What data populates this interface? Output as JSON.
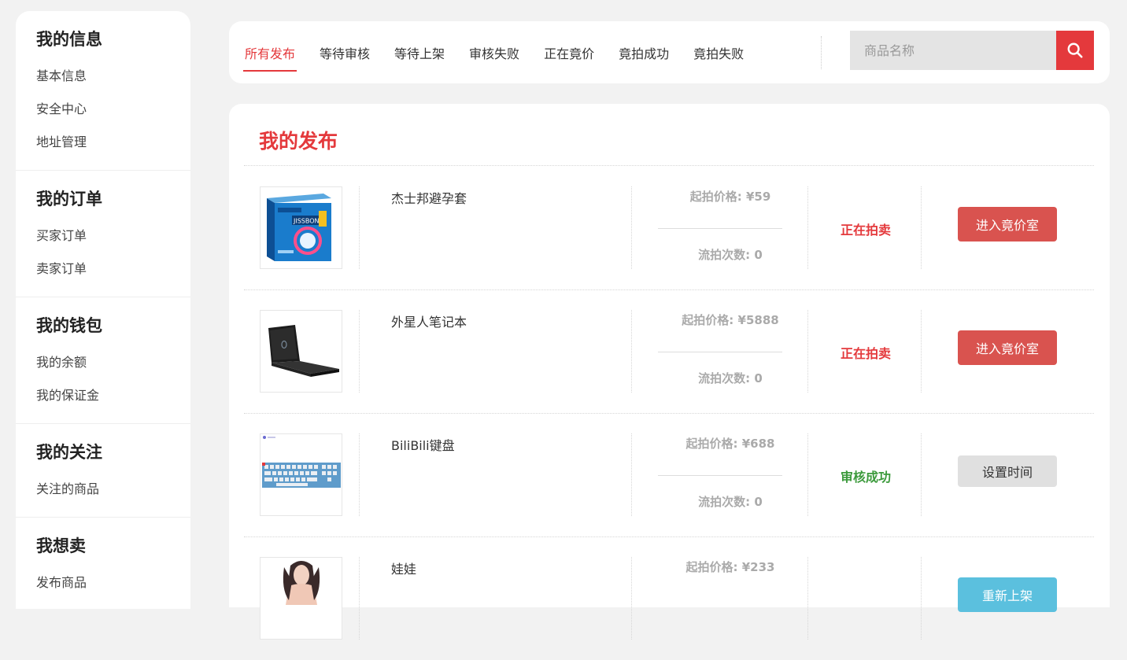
{
  "sidebar": {
    "groups": [
      {
        "title": "我的信息",
        "items": [
          "基本信息",
          "安全中心",
          "地址管理"
        ]
      },
      {
        "title": "我的订单",
        "items": [
          "买家订单",
          "卖家订单"
        ]
      },
      {
        "title": "我的钱包",
        "items": [
          "我的余额",
          "我的保证金"
        ]
      },
      {
        "title": "我的关注",
        "items": [
          "关注的商品"
        ]
      },
      {
        "title": "我想卖",
        "items": [
          "发布商品"
        ]
      }
    ]
  },
  "tabs": [
    "所有发布",
    "等待审核",
    "等待上架",
    "审核失败",
    "正在竟价",
    "竟拍成功",
    "竟拍失败"
  ],
  "active_tab": 0,
  "search": {
    "placeholder": "商品名称",
    "value": "",
    "icon": "search-icon"
  },
  "main": {
    "title": "我的发布",
    "products": [
      {
        "name": "杰士邦避孕套",
        "price": "起拍价格: ¥59",
        "count": "流拍次数: 0",
        "status": "正在拍卖",
        "status_color": "#e4393c",
        "action": "进入竟价室",
        "action_style": "red",
        "thumb": "condom-box-image"
      },
      {
        "name": "外星人笔记本",
        "price": "起拍价格: ¥5888",
        "count": "流拍次数: 0",
        "status": "正在拍卖",
        "status_color": "#e4393c",
        "action": "进入竟价室",
        "action_style": "red",
        "thumb": "laptop-image"
      },
      {
        "name": "BiliBili键盘",
        "price": "起拍价格: ¥688",
        "count": "流拍次数: 0",
        "status": "审核成功",
        "status_color": "#3c9a3c",
        "action": "设置时间",
        "action_style": "gray",
        "thumb": "keyboard-image"
      },
      {
        "name": "娃娃",
        "price": "起拍价格: ¥233",
        "count": "",
        "status": "",
        "status_color": "#e4393c",
        "action": "重新上架",
        "action_style": "blue",
        "thumb": "doll-image"
      }
    ]
  },
  "colors": {
    "accent": "#e4393c",
    "success": "#3c9a3c",
    "button_red": "#d9534f",
    "button_blue": "#5bc0de"
  }
}
